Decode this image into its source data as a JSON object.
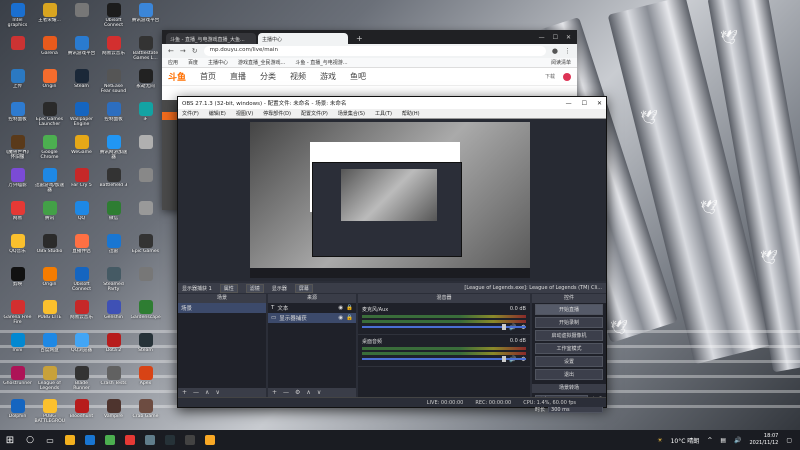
{
  "desktop": {
    "icons": [
      {
        "label": "Intel graphics",
        "color": "#1a6fd0"
      },
      {
        "label": "王者荣耀...",
        "color": "#d9a520"
      },
      {
        "label": "​",
        "color": "#777"
      },
      {
        "label": "Ubisoft Connect",
        "color": "#1c1c1c"
      },
      {
        "label": "腾讯游戏平台",
        "color": "#3b86d9"
      },
      {
        "label": "​",
        "color": "#cc3333"
      },
      {
        "label": "Garena",
        "color": "#e85a1c"
      },
      {
        "label": "腾讯游戏平台",
        "color": "#2a7bd0"
      },
      {
        "label": "网易云音乐",
        "color": "#d32f2f"
      },
      {
        "label": "Battlestate Games L...",
        "color": "#333"
      },
      {
        "label": "上传",
        "color": "#2b79c2"
      },
      {
        "label": "Origin",
        "color": "#f56c2d"
      },
      {
        "label": "Steam",
        "color": "#1b2838"
      },
      {
        "label": "NetEase Fear sound",
        "color": "#555"
      },
      {
        "label": "永劫无间",
        "color": "#222"
      },
      {
        "label": "控制面板",
        "color": "#2e7bd0"
      },
      {
        "label": "Epic Games Launcher",
        "color": "#2a2a2a"
      },
      {
        "label": "Wallpaper Engine",
        "color": "#1565c0"
      },
      {
        "label": "控制面板",
        "color": "#2c6ec0"
      },
      {
        "label": "iF",
        "color": "#13a3a3"
      },
      {
        "label": "《魔兽世界》怀旧服",
        "color": "#5a3a1a"
      },
      {
        "label": "Google Chrome",
        "color": "#4caf50"
      },
      {
        "label": "WeGame",
        "color": "#e6a817"
      },
      {
        "label": "腾讯网游加速器",
        "color": "#2196f3"
      },
      {
        "label": "​",
        "color": "#b0b0b0"
      },
      {
        "label": "万兴喵影",
        "color": "#7b4bd6"
      },
      {
        "label": "迅雷游戏/加速器",
        "color": "#1e88e5"
      },
      {
        "label": "Far Cry 5",
        "color": "#c62828"
      },
      {
        "label": "Battlefield 3",
        "color": "#333"
      },
      {
        "label": "​",
        "color": "#888"
      },
      {
        "label": "网易",
        "color": "#e53935"
      },
      {
        "label": "腾讯",
        "color": "#43a047"
      },
      {
        "label": "QQ",
        "color": "#1e88e5"
      },
      {
        "label": "微信",
        "color": "#2e7d32"
      },
      {
        "label": "​",
        "color": "#999"
      },
      {
        "label": "QQ音乐",
        "color": "#fbc02d"
      },
      {
        "label": "OBS Studio",
        "color": "#2b2b2b"
      },
      {
        "label": "直播伴侣",
        "color": "#ff7043"
      },
      {
        "label": "迅雷",
        "color": "#1976d2"
      },
      {
        "label": "Epic Games",
        "color": "#333"
      },
      {
        "label": "剪映",
        "color": "#111"
      },
      {
        "label": "Origin",
        "color": "#f57c00"
      },
      {
        "label": "Ubisoft Connect",
        "color": "#1565c0"
      },
      {
        "label": "Steamed Party",
        "color": "#455a64"
      },
      {
        "label": "​",
        "color": "#777"
      },
      {
        "label": "Garena Free Fire",
        "color": "#d32f2f"
      },
      {
        "label": "PUBG LITE",
        "color": "#fbc02d"
      },
      {
        "label": "网易云音乐",
        "color": "#c62828"
      },
      {
        "label": "Genshin",
        "color": "#3f51b5"
      },
      {
        "label": "Gardenscapes",
        "color": "#2e7d32"
      },
      {
        "label": "mini",
        "color": "#0288d1"
      },
      {
        "label": "百度网盘",
        "color": "#1e88e5"
      },
      {
        "label": "QQ浏览器",
        "color": "#42a5f5"
      },
      {
        "label": "Dota 2",
        "color": "#b71c1c"
      },
      {
        "label": "Steam",
        "color": "#263238"
      },
      {
        "label": "Ghostrunner",
        "color": "#ad1457"
      },
      {
        "label": "League of Legends",
        "color": "#c8a13a"
      },
      {
        "label": "Blade Runner",
        "color": "#333"
      },
      {
        "label": "Crash Tests",
        "color": "#616161"
      },
      {
        "label": "Apex",
        "color": "#d84315"
      },
      {
        "label": "Dolphin",
        "color": "#1565c0"
      },
      {
        "label": "PUBG BATTLEGROUNDS",
        "color": "#fbc02d"
      },
      {
        "label": "Bloodhunt",
        "color": "#b71c1c"
      },
      {
        "label": "Vampire",
        "color": "#4e342e"
      },
      {
        "label": "Crab Game",
        "color": "#6d4c41"
      }
    ]
  },
  "browser": {
    "tabs": [
      "斗鱼 - 直播_与电游戏直播_大鱼...",
      "主播中心"
    ],
    "url": "mp.douyu.com/live/main",
    "bookmarks": [
      "应用",
      "百度",
      "主播中心",
      "游戏直播_全民游戏...",
      "斗鱼 - 直播_与电视游..."
    ],
    "bookmarks_right": "阅读清单",
    "site_logo": "斗鱼",
    "nav": [
      "首页",
      "直播",
      "分类",
      "视频",
      "游戏",
      "鱼吧"
    ],
    "site_right": "下载"
  },
  "obs": {
    "title": "OBS 27.1.3 (32-bit, windows) - 配置文件: 未命名 - 场景: 未命名",
    "menu": [
      "文件(F)",
      "编辑(E)",
      "视图(V)",
      "停靠部件(D)",
      "配置文件(P)",
      "场景集合(S)",
      "工具(T)",
      "帮助(H)"
    ],
    "source_toolbar": [
      "显示器捕获 1",
      "属性",
      "滤镜",
      "显示器",
      "屏幕",
      "[League of Legends.exe]: League of Legends (TM) Cli..."
    ],
    "docks": {
      "scenes": {
        "title": "场景",
        "items": [
          "场景"
        ]
      },
      "sources": {
        "title": "来源",
        "items": [
          "文本",
          "显示器捕获"
        ]
      },
      "mixer": {
        "title": "混音器",
        "channels": [
          {
            "name": "麦克风/Aux",
            "db": "0.0 dB"
          },
          {
            "name": "桌面音频",
            "db": "0.0 dB"
          }
        ]
      },
      "controls": {
        "title": "控件",
        "buttons": [
          "开始直播",
          "开始录制",
          "启动虚拟摄像机",
          "工作室模式",
          "设置",
          "退出"
        ],
        "transition_title": "场景转场",
        "transition_value": "淡出",
        "duration_label": "时长",
        "duration_value": "300 ms"
      }
    },
    "status": {
      "live": "LIVE: 00:00:00",
      "rec": "REC: 00:00:00",
      "cpu": "CPU: 1.4%, 60.00 fps"
    }
  },
  "taskbar": {
    "weather": "10°C 晴朗",
    "time": "18:07",
    "date": "2021/11/12",
    "app_colors": [
      "#f2b01e",
      "#1976d2",
      "#4caf50",
      "#e53935",
      "#607d8b",
      "#263238",
      "#424242",
      "#f9a825"
    ]
  }
}
